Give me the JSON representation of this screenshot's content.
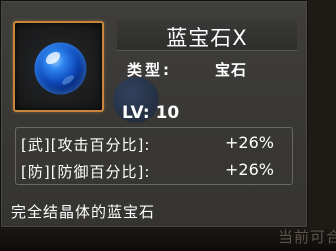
{
  "item": {
    "name": "蓝宝石X",
    "type_label": "类型:",
    "type_value": "宝石",
    "level": "LV: 10",
    "icon": "blue-gem-orb-icon",
    "description": "完全结晶体的蓝宝石"
  },
  "stats": [
    {
      "label": "[武][攻击百分比]:",
      "value": "+26%"
    },
    {
      "label": "[防][防御百分比]:",
      "value": "+26%"
    }
  ],
  "background": {
    "hint_text": "当前可合"
  },
  "colors": {
    "frame_accent": "#c9853a",
    "panel_bg": "#3a3937",
    "gem_blue": "#1e6fe0"
  }
}
